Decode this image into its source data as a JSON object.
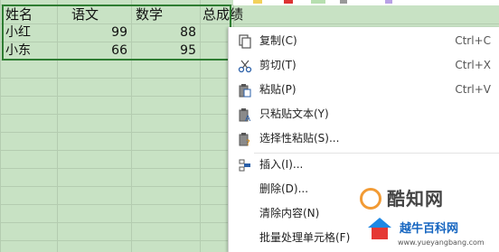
{
  "sheet": {
    "headers": [
      "姓名",
      "语文",
      "数学",
      "总成绩"
    ],
    "rows": [
      {
        "name": "小红",
        "chinese": "99",
        "math": "88"
      },
      {
        "name": "小东",
        "chinese": "66",
        "math": "95"
      }
    ]
  },
  "context_menu": {
    "copy": {
      "label": "复制(C)",
      "shortcut": "Ctrl+C"
    },
    "cut": {
      "label": "剪切(T)",
      "shortcut": "Ctrl+X"
    },
    "paste": {
      "label": "粘贴(P)",
      "shortcut": "Ctrl+V"
    },
    "paste_text": {
      "label": "只粘贴文本(Y)"
    },
    "paste_special": {
      "label": "选择性粘贴(S)..."
    },
    "insert": {
      "label": "插入(I)..."
    },
    "delete": {
      "label": "删除(D)..."
    },
    "clear": {
      "label": "清除内容(N)"
    },
    "batch": {
      "label": "批量处理单元格(F)"
    }
  },
  "watermark": {
    "site": "酷知网",
    "site2": "越牛百科网",
    "url": "www.yueyangbang.com"
  },
  "colors": {
    "sheet_bg": "#c8e2c4",
    "selection_border": "#2e7d32",
    "menu_bg": "#ffffff"
  }
}
